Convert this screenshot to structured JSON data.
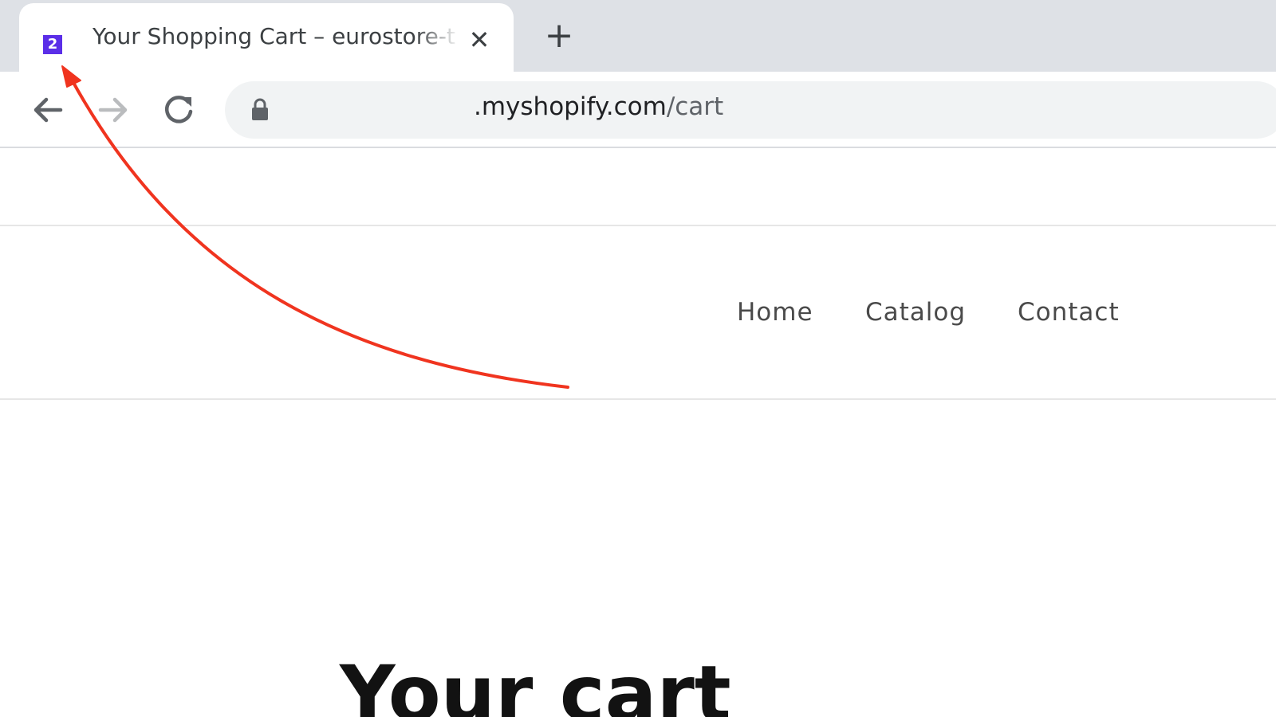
{
  "browser": {
    "tab": {
      "favicon_text": "2",
      "favicon_color": "#5b2ee8",
      "title": "Your Shopping Cart – eurostore-t",
      "close_icon": "close-icon"
    },
    "new_tab_icon": "plus-icon",
    "toolbar": {
      "back_icon": "back-arrow-icon",
      "forward_icon": "forward-arrow-icon",
      "reload_icon": "reload-icon",
      "lock_icon": "lock-icon"
    },
    "address_bar": {
      "domain": ".myshopify.com",
      "path": "/cart"
    }
  },
  "site": {
    "nav": {
      "items": [
        "Home",
        "Catalog",
        "Contact"
      ]
    },
    "page_title": "Your cart"
  },
  "annotation": {
    "arrow_color": "#f0341f"
  }
}
